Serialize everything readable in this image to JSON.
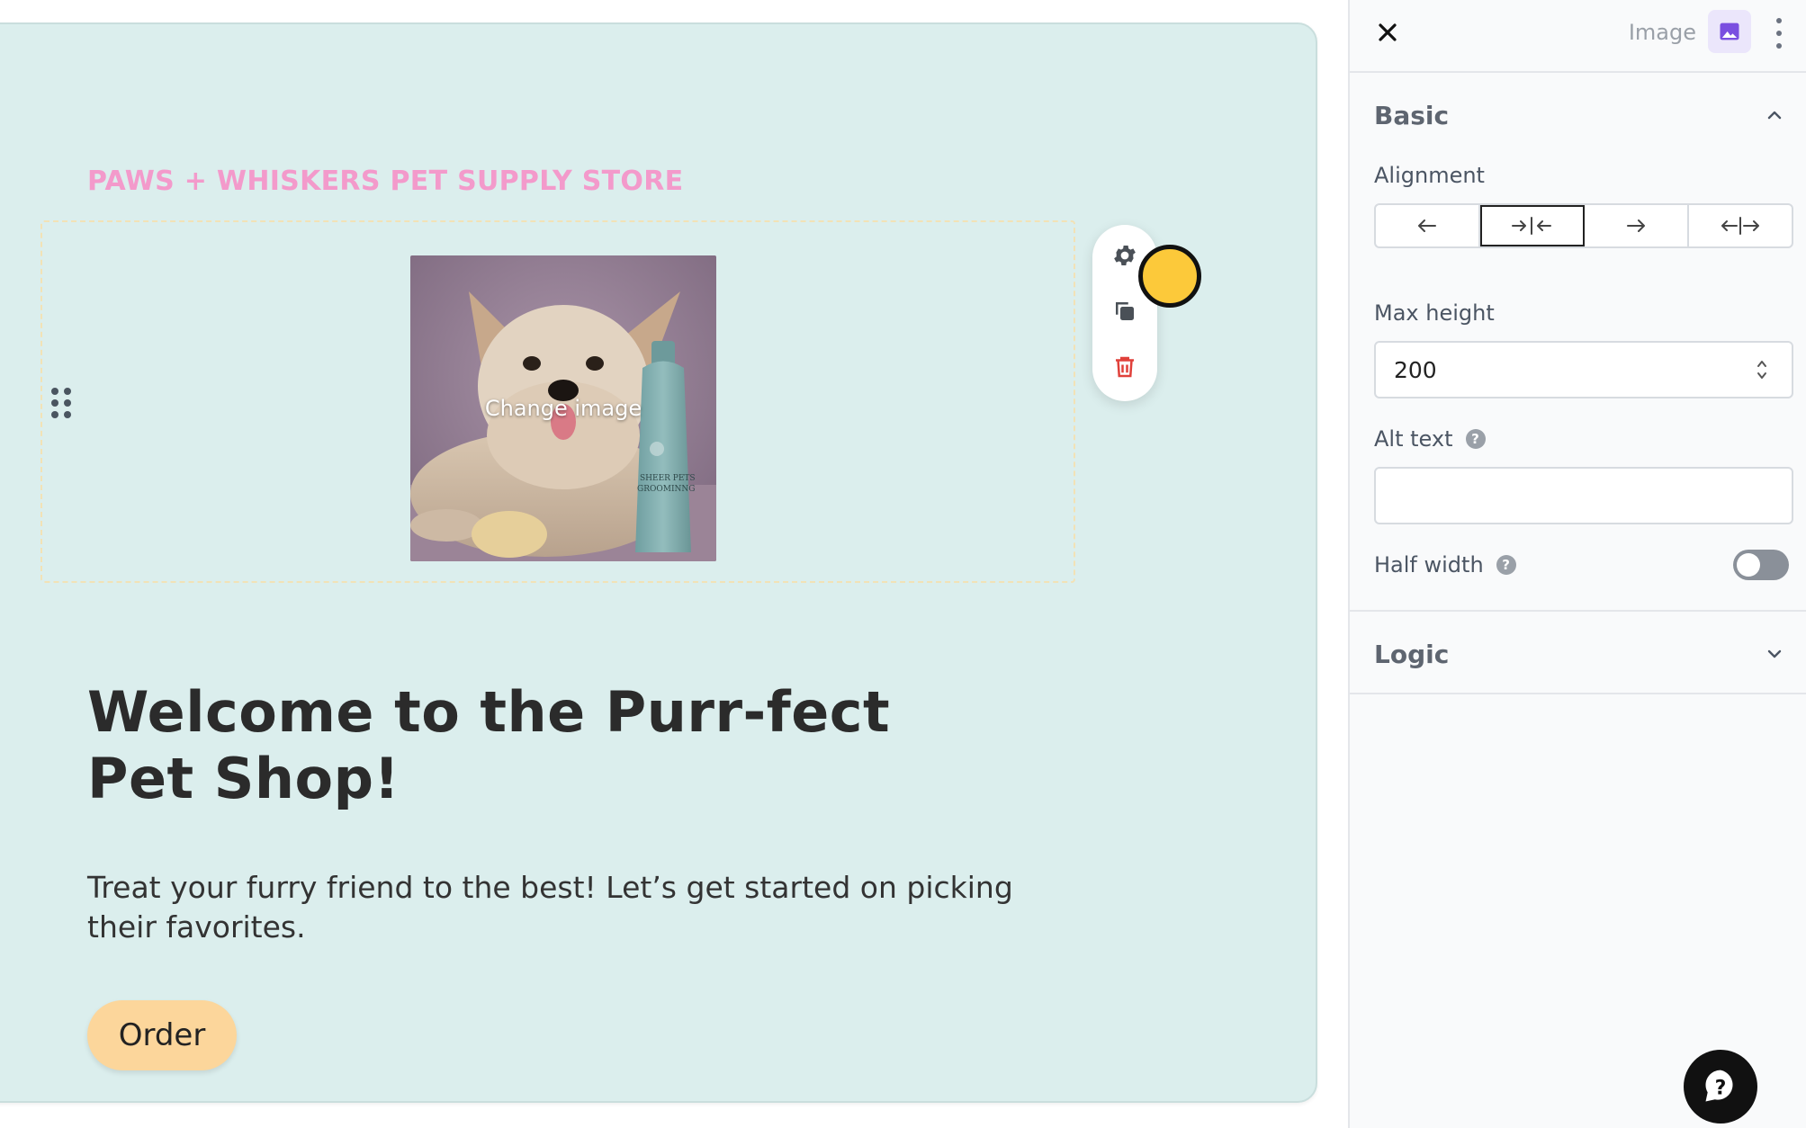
{
  "canvas": {
    "eyebrow": "PAWS + WHISKERS PET SUPPLY STORE",
    "image_overlay_label": "Change image",
    "headline": "Welcome to the Purr-fect Pet Shop!",
    "body": "Treat your furry friend to the best! Let’s get started on picking their favorites.",
    "order_button": "Order",
    "toolbar_icons": [
      "gear-icon",
      "duplicate-icon",
      "trash-icon"
    ]
  },
  "panel": {
    "type_label": "Image",
    "basic": {
      "title": "Basic",
      "alignment_label": "Alignment",
      "alignment_options": [
        "align-left",
        "align-center",
        "align-right",
        "full-width"
      ],
      "alignment_selected": "align-center",
      "max_height_label": "Max height",
      "max_height_value": "200",
      "alt_text_label": "Alt text",
      "alt_text_value": "",
      "half_width_label": "Half width",
      "half_width_enabled": false
    },
    "logic": {
      "title": "Logic"
    }
  },
  "colors": {
    "canvas_background": "#dbeeed",
    "eyebrow": "#f39acb",
    "order_button": "#fcd69b",
    "delete_icon": "#e0403a",
    "badge_icon": "#7a4fe0"
  }
}
